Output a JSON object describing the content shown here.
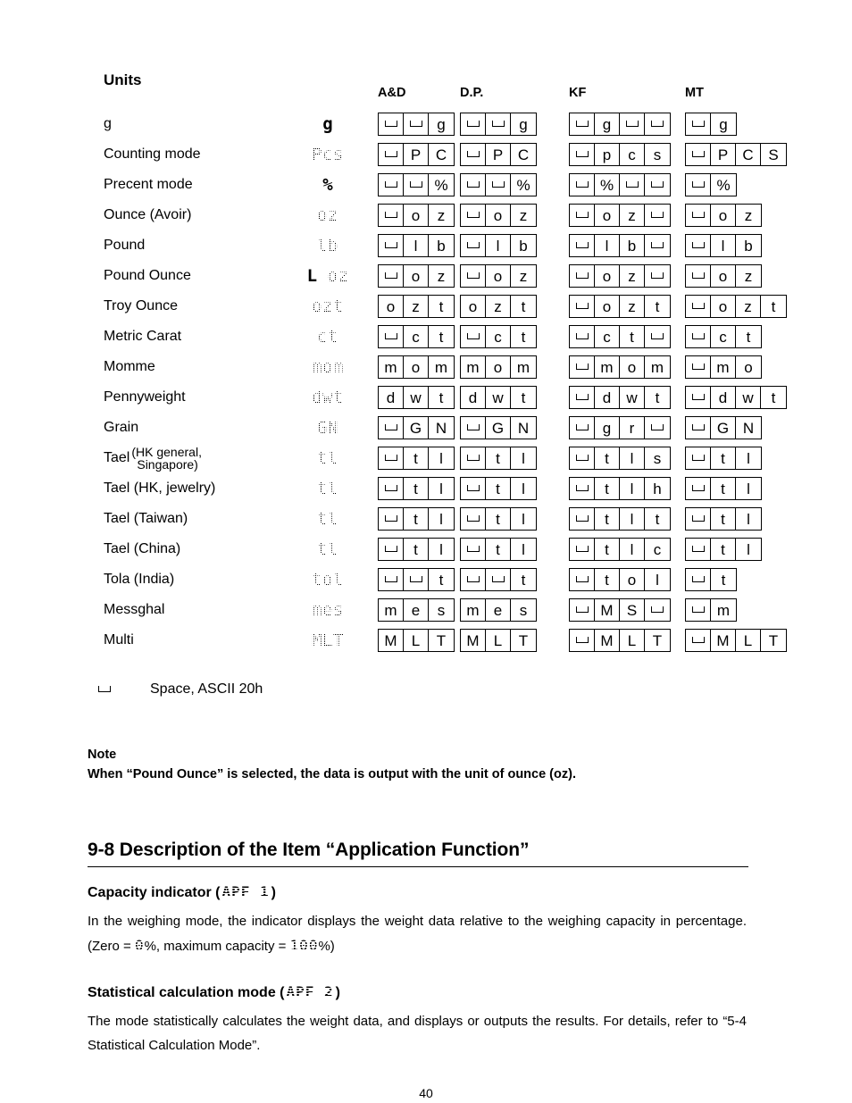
{
  "table": {
    "units_title": "Units",
    "column_headers": [
      "A&D",
      "D.P.",
      "KF",
      "MT"
    ],
    "rows": [
      {
        "label": "g",
        "display": "g",
        "display_style": "plain",
        "and": [
          "_",
          "_",
          "g"
        ],
        "dp": [
          "_",
          "_",
          "g"
        ],
        "kf": [
          "_",
          "g",
          "_",
          "_"
        ],
        "mt": [
          "_",
          "g"
        ]
      },
      {
        "label": "Counting mode",
        "display": "Pcs",
        "display_style": "dot",
        "and": [
          "_",
          "P",
          "C"
        ],
        "dp": [
          "_",
          "P",
          "C"
        ],
        "kf": [
          "_",
          "p",
          "c",
          "s"
        ],
        "mt": [
          "_",
          "P",
          "C",
          "S"
        ]
      },
      {
        "label": "Precent mode",
        "display": "%",
        "display_style": "plain",
        "and": [
          "_",
          "_",
          "%"
        ],
        "dp": [
          "_",
          "_",
          "%"
        ],
        "kf": [
          "_",
          "%",
          "_",
          "_"
        ],
        "mt": [
          "_",
          "%"
        ]
      },
      {
        "label": "Ounce (Avoir)",
        "display": "oz",
        "display_style": "dot",
        "and": [
          "_",
          "o",
          "z"
        ],
        "dp": [
          "_",
          "o",
          "z"
        ],
        "kf": [
          "_",
          "o",
          "z",
          "_"
        ],
        "mt": [
          "_",
          "o",
          "z"
        ]
      },
      {
        "label": "Pound",
        "display": "lb",
        "display_style": "dot",
        "and": [
          "_",
          "l",
          "b"
        ],
        "dp": [
          "_",
          "l",
          "b"
        ],
        "kf": [
          "_",
          "l",
          "b",
          "_"
        ],
        "mt": [
          "_",
          "l",
          "b"
        ]
      },
      {
        "label": "Pound Ounce",
        "display": "oz",
        "display_style": "dot",
        "display_prefix": "L",
        "and": [
          "_",
          "o",
          "z"
        ],
        "dp": [
          "_",
          "o",
          "z"
        ],
        "kf": [
          "_",
          "o",
          "z",
          "_"
        ],
        "mt": [
          "_",
          "o",
          "z"
        ]
      },
      {
        "label": "Troy Ounce",
        "display": "ozt",
        "display_style": "dot",
        "and": [
          "o",
          "z",
          "t"
        ],
        "dp": [
          "o",
          "z",
          "t"
        ],
        "kf": [
          "_",
          "o",
          "z",
          "t"
        ],
        "mt": [
          "_",
          "o",
          "z",
          "t"
        ]
      },
      {
        "label": "Metric Carat",
        "display": "ct",
        "display_style": "dot",
        "and": [
          "_",
          "c",
          "t"
        ],
        "dp": [
          "_",
          "c",
          "t"
        ],
        "kf": [
          "_",
          "c",
          "t",
          "_"
        ],
        "mt": [
          "_",
          "c",
          "t"
        ]
      },
      {
        "label": "Momme",
        "display": "mom",
        "display_style": "dot",
        "and": [
          "m",
          "o",
          "m"
        ],
        "dp": [
          "m",
          "o",
          "m"
        ],
        "kf": [
          "_",
          "m",
          "o",
          "m"
        ],
        "mt": [
          "_",
          "m",
          "o"
        ]
      },
      {
        "label": "Pennyweight",
        "display": "dwt",
        "display_style": "dot",
        "and": [
          "d",
          "w",
          "t"
        ],
        "dp": [
          "d",
          "w",
          "t"
        ],
        "kf": [
          "_",
          "d",
          "w",
          "t"
        ],
        "mt": [
          "_",
          "d",
          "w",
          "t"
        ]
      },
      {
        "label": "Grain",
        "display": "GN",
        "display_style": "dot",
        "and": [
          "_",
          "G",
          "N"
        ],
        "dp": [
          "_",
          "G",
          "N"
        ],
        "kf": [
          "_",
          "g",
          "r",
          "_"
        ],
        "mt": [
          "_",
          "G",
          "N"
        ]
      },
      {
        "label": "Tael",
        "label_paren_line1": "(HK general,",
        "label_paren_line2": "Singapore)",
        "display": "tl",
        "display_style": "dot",
        "and": [
          "_",
          "t",
          "l"
        ],
        "dp": [
          "_",
          "t",
          "l"
        ],
        "kf": [
          "_",
          "t",
          "l",
          "s"
        ],
        "mt": [
          "_",
          "t",
          "l"
        ]
      },
      {
        "label": "Tael (HK, jewelry)",
        "display": "tl",
        "display_style": "dot",
        "and": [
          "_",
          "t",
          "l"
        ],
        "dp": [
          "_",
          "t",
          "l"
        ],
        "kf": [
          "_",
          "t",
          "l",
          "h"
        ],
        "mt": [
          "_",
          "t",
          "l"
        ]
      },
      {
        "label": "Tael (Taiwan)",
        "display": "tl",
        "display_style": "dot",
        "and": [
          "_",
          "t",
          "l"
        ],
        "dp": [
          "_",
          "t",
          "l"
        ],
        "kf": [
          "_",
          "t",
          "l",
          "t"
        ],
        "mt": [
          "_",
          "t",
          "l"
        ]
      },
      {
        "label": "Tael (China)",
        "display": "tl",
        "display_style": "dot",
        "and": [
          "_",
          "t",
          "l"
        ],
        "dp": [
          "_",
          "t",
          "l"
        ],
        "kf": [
          "_",
          "t",
          "l",
          "c"
        ],
        "mt": [
          "_",
          "t",
          "l"
        ]
      },
      {
        "label": "Tola (India)",
        "display": "tol",
        "display_style": "dot",
        "and": [
          "_",
          "_",
          "t"
        ],
        "dp": [
          "_",
          "_",
          "t"
        ],
        "kf": [
          "_",
          "t",
          "o",
          "l"
        ],
        "mt": [
          "_",
          "t"
        ]
      },
      {
        "label": "Messghal",
        "display": "mes",
        "display_style": "dot",
        "and": [
          "m",
          "e",
          "s"
        ],
        "dp": [
          "m",
          "e",
          "s"
        ],
        "kf": [
          "_",
          "M",
          "S",
          "_"
        ],
        "mt": [
          "_",
          "m"
        ]
      },
      {
        "label": "Multi",
        "display": "MLT",
        "display_style": "dot",
        "and": [
          "M",
          "L",
          "T"
        ],
        "dp": [
          "M",
          "L",
          "T"
        ],
        "kf": [
          "_",
          "M",
          "L",
          "T"
        ],
        "mt": [
          "_",
          "M",
          "L",
          "T"
        ]
      }
    ]
  },
  "legend": {
    "text": "Space,  ASCII  20h"
  },
  "note": {
    "heading": "Note",
    "text": "When “Pound Ounce” is selected, the data is output with the unit of ounce (oz)."
  },
  "section": {
    "title": "9-8  Description of the Item “Application Function”",
    "sub1": {
      "heading_before": "Capacity indicator (",
      "code": "APF 1",
      "heading_after": ")",
      "body_part1": "In the weighing mode, the indicator displays the weight data relative to the weighing capacity in percentage. (Zero = ",
      "code_zero": "0",
      "body_part2": "%, maximum capacity = ",
      "code_max": "100",
      "body_part3": "%)"
    },
    "sub2": {
      "heading_before": "Statistical calculation mode (",
      "code": "APF 2",
      "heading_after": ")",
      "body": "The mode statistically calculates the weight data, and displays or outputs the results. For details, refer to “5-4 Statistical Calculation Mode”."
    }
  },
  "footer": {
    "page_number": "40"
  }
}
